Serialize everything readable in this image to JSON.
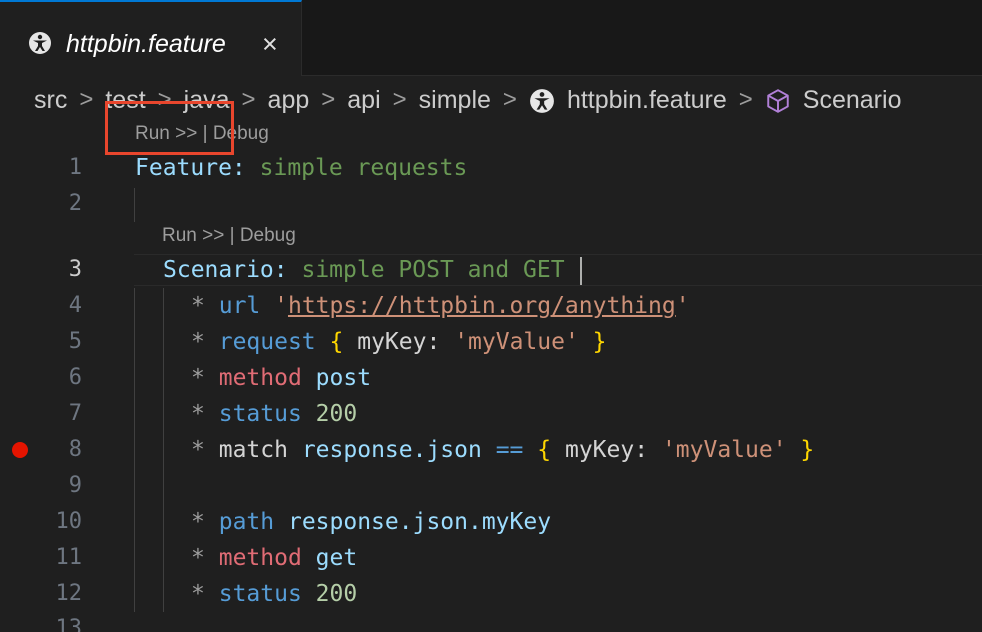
{
  "tab": {
    "title": "httpbin.feature",
    "close": "×",
    "icon": "karate-icon"
  },
  "breadcrumb": {
    "items": [
      "src",
      "test",
      "java",
      "app",
      "api",
      "simple"
    ],
    "file": "httpbin.feature",
    "symbol": "Scenario",
    "separator": ">"
  },
  "codelens": [
    {
      "run": "Run >>",
      "sep": "|",
      "debug": "Debug"
    },
    {
      "run": "Run >>",
      "sep": "|",
      "debug": "Debug"
    }
  ],
  "line_numbers": [
    "1",
    "2",
    "3",
    "4",
    "5",
    "6",
    "7",
    "8",
    "9",
    "10",
    "11",
    "12",
    "13"
  ],
  "code": {
    "l1": {
      "kw": "Feature:",
      "text": "simple requests"
    },
    "l3": {
      "kw": "Scenario:",
      "text": "simple POST and GET"
    },
    "l4": {
      "star": "*",
      "kw": "url",
      "q1": "'",
      "url": "https://httpbin.org/anything",
      "q2": "'"
    },
    "l5": {
      "star": "*",
      "kw": "request",
      "open": "{",
      "key": "myKey:",
      "val": "'myValue'",
      "close": "}"
    },
    "l6": {
      "star": "*",
      "kw": "method",
      "arg": "post"
    },
    "l7": {
      "star": "*",
      "kw": "status",
      "num": "200"
    },
    "l8": {
      "star": "*",
      "kw": "match",
      "expr": "response.json",
      "op": "==",
      "open": "{",
      "key": "myKey:",
      "val": "'myValue'",
      "close": "}"
    },
    "l10": {
      "star": "*",
      "kw": "path",
      "expr": "response.json.myKey"
    },
    "l11": {
      "star": "*",
      "kw": "method",
      "arg": "get"
    },
    "l12": {
      "star": "*",
      "kw": "status",
      "num": "200"
    }
  },
  "colors": {
    "accent": "#0078d4",
    "highlight_box": "#e8462d",
    "breakpoint": "#e51400"
  }
}
